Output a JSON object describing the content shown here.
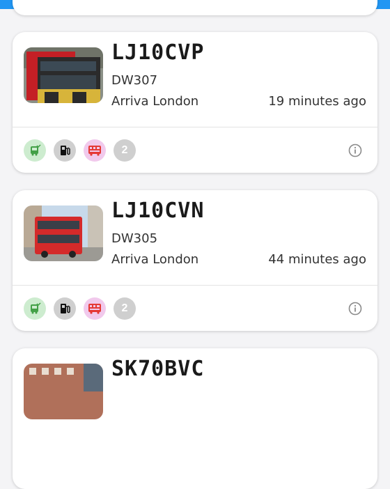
{
  "colors": {
    "topbar": "#2196f3",
    "bus_chip": "#cdeccf",
    "fuel_chip": "#cfcfcf",
    "deck_chip": "#f1c9ec",
    "bus_icon": "#43a047",
    "deck_icon": "#e53935"
  },
  "vehicles": [
    {
      "registration": "LJ10CVP",
      "fleet_number": "DW307",
      "operator": "Arriva London",
      "last_seen": "19 minutes ago",
      "extra_count": "2",
      "icons": [
        "bus-check-icon",
        "fuel-pump-icon",
        "double-decker-icon",
        "info-icon"
      ]
    },
    {
      "registration": "LJ10CVN",
      "fleet_number": "DW305",
      "operator": "Arriva London",
      "last_seen": "44 minutes ago",
      "extra_count": "2",
      "icons": [
        "bus-check-icon",
        "fuel-pump-icon",
        "double-decker-icon",
        "info-icon"
      ]
    },
    {
      "registration": "SK70BVC"
    }
  ]
}
